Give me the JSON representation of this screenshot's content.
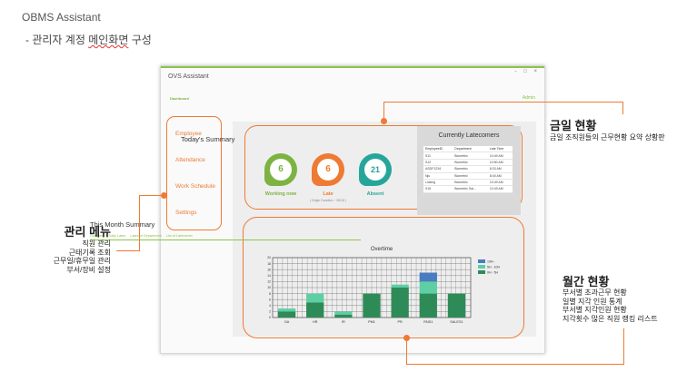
{
  "doc": {
    "title": "OBMS Assistant",
    "subtitle_prefix": "- 관리자 계정 ",
    "subtitle_underlined": "메인화면",
    "subtitle_suffix": " 구성"
  },
  "window": {
    "title": "OVS Assistant",
    "controls": "- □ ×",
    "tab": "Dashboard",
    "admin_link": "Admin"
  },
  "menu": {
    "items": [
      "Employee",
      "Attendance",
      "Work Schedule",
      "Settings"
    ]
  },
  "today_summary": {
    "title": "Today's Summary",
    "working": {
      "value": "6",
      "label": "Working now",
      "color": "#7cb342"
    },
    "late": {
      "value": "6",
      "label": "Late",
      "note": "( Origin Duration ~ 08:30 )",
      "color": "#ee7a33"
    },
    "absent": {
      "value": "21",
      "label": "Absent",
      "color": "#26a69a"
    }
  },
  "latecomers": {
    "title": "Currently Latecomers",
    "columns": [
      "EmployeeID",
      "Department",
      "Late Time"
    ],
    "rows": [
      [
        "S11",
        "Biometric",
        "10:49 AM"
      ],
      [
        "S12",
        "Biometric",
        "10:50 AM"
      ],
      [
        "ASDF1234",
        "Biometric",
        "8:33 AM"
      ],
      [
        "Nju",
        "Biometric",
        "8:40 AM"
      ],
      [
        "Lioking",
        "Biometric",
        "10:49 AM"
      ],
      [
        "S15",
        "Biometric Sal...",
        "10:49 AM"
      ]
    ]
  },
  "month_summary": {
    "title": "This Month Summary",
    "tabs": [
      "Overtime",
      "Daily Lates",
      "Lates of Department",
      "List of Latecomer"
    ]
  },
  "chart_data": {
    "type": "bar",
    "title": "Overtime",
    "categories": [
      "GA",
      "HR",
      "IR",
      "PM1",
      "PR",
      "RND1",
      "SALES1"
    ],
    "series": [
      {
        "name": "0H - 5H",
        "color": "#2e8b57",
        "values": [
          2,
          5,
          1,
          8,
          10,
          8,
          8
        ]
      },
      {
        "name": "5H - 10H",
        "color": "#5ecfa4",
        "values": [
          1,
          3,
          1,
          0,
          1,
          4,
          0
        ]
      },
      {
        "name": "10H~",
        "color": "#4a7cc0",
        "values": [
          0,
          0,
          0,
          0,
          0,
          3,
          0
        ]
      }
    ],
    "yticks": [
      0,
      2,
      4,
      6,
      8,
      10,
      12,
      14,
      16,
      18,
      20
    ],
    "ylim": [
      0,
      20
    ],
    "grid": true,
    "legend": "top-right"
  },
  "annotations": {
    "absence": {
      "title": "금일 현황",
      "lines": [
        "금일 조직원들의 근무현황 요약 상황판"
      ]
    },
    "menu": {
      "title": "관리 메뉴",
      "lines": [
        "직원 관리",
        "근태기록 조회",
        "근무일/휴무일 관리",
        "부서/장비 설정"
      ]
    },
    "monthly": {
      "title": "월간 현황",
      "lines": [
        "부서별 초과근무 현황",
        "일별 지각 인원 통계",
        "부서별 지각인원 현황",
        "지각횟수 많은 직원 랭킹 리스트"
      ]
    }
  },
  "colors": {
    "accent_green": "#8bc34a",
    "accent_orange": "#ee7a33"
  }
}
